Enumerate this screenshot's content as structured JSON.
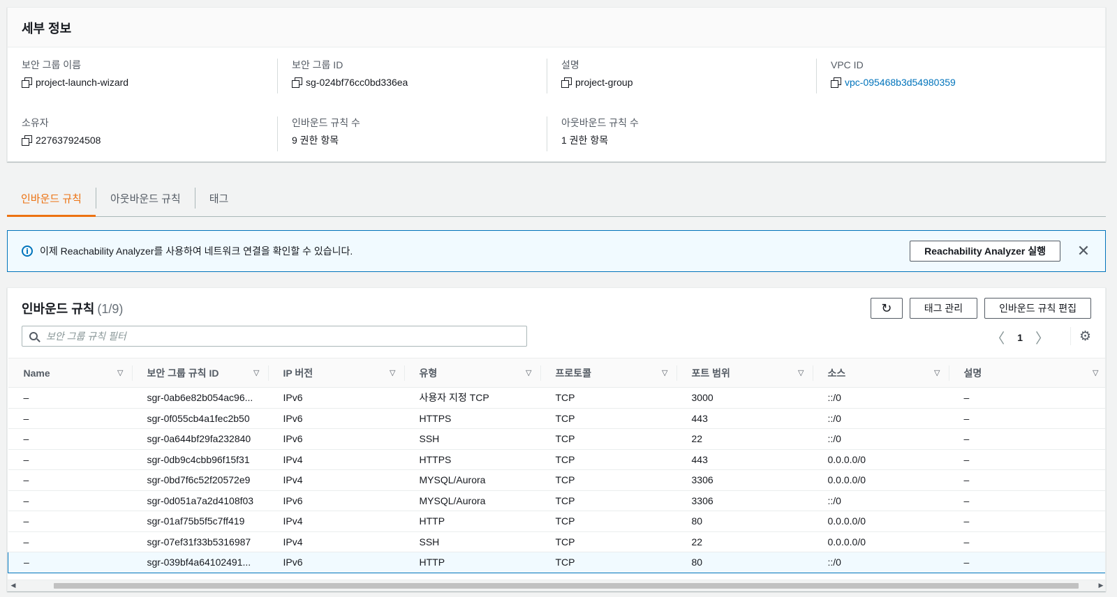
{
  "details": {
    "title": "세부 정보",
    "fields": [
      {
        "label": "보안 그룹 이름",
        "value": "project-launch-wizard"
      },
      {
        "label": "보안 그룹 ID",
        "value": "sg-024bf76cc0bd336ea"
      },
      {
        "label": "설명",
        "value": "project-group"
      },
      {
        "label": "VPC ID",
        "value": "vpc-095468b3d54980359"
      },
      {
        "label": "소유자",
        "value": "227637924508"
      },
      {
        "label": "인바운드 규칙 수",
        "value": "9 권한 항목"
      },
      {
        "label": "아웃바운드 규칙 수",
        "value": "1 권한 항목"
      }
    ]
  },
  "tabs": [
    {
      "label": "인바운드 규칙",
      "active": true
    },
    {
      "label": "아웃바운드 규칙",
      "active": false
    },
    {
      "label": "태그",
      "active": false
    }
  ],
  "flash": {
    "info_icon": "info-icon",
    "message": "이제 Reachability Analyzer를 사용하여 네트워크 연결을 확인할 수 있습니다.",
    "button": "Reachability Analyzer 실행",
    "close": "✕"
  },
  "rules_panel": {
    "title": "인바운드 규칙",
    "count": "(1/9)",
    "refresh_icon": "↻",
    "manage_tags": "태그 관리",
    "edit_rules": "인바운드 규칙 편집",
    "search_placeholder": "보안 그룹 규칙 필터",
    "page": "1",
    "prev": "〈",
    "next": "〉",
    "settings_icon": "⚙",
    "columns": [
      "Name",
      "보안 그룹 규칙 ID",
      "IP 버전",
      "유형",
      "프로토콜",
      "포트 범위",
      "소스",
      "설명"
    ],
    "sort_icon": "▽",
    "rows": [
      [
        "–",
        "sgr-0ab6e82b054ac96...",
        "IPv6",
        "사용자 지정 TCP",
        "TCP",
        "3000",
        "::/0",
        "–"
      ],
      [
        "–",
        "sgr-0f055cb4a1fec2b50",
        "IPv6",
        "HTTPS",
        "TCP",
        "443",
        "::/0",
        "–"
      ],
      [
        "–",
        "sgr-0a644bf29fa232840",
        "IPv6",
        "SSH",
        "TCP",
        "22",
        "::/0",
        "–"
      ],
      [
        "–",
        "sgr-0db9c4cbb96f15f31",
        "IPv4",
        "HTTPS",
        "TCP",
        "443",
        "0.0.0.0/0",
        "–"
      ],
      [
        "–",
        "sgr-0bd7f6c52f20572e9",
        "IPv4",
        "MYSQL/Aurora",
        "TCP",
        "3306",
        "0.0.0.0/0",
        "–"
      ],
      [
        "–",
        "sgr-0d051a7a2d4108f03",
        "IPv6",
        "MYSQL/Aurora",
        "TCP",
        "3306",
        "::/0",
        "–"
      ],
      [
        "–",
        "sgr-01af75b5f5c7ff419",
        "IPv4",
        "HTTP",
        "TCP",
        "80",
        "0.0.0.0/0",
        "–"
      ],
      [
        "–",
        "sgr-07ef31f33b5316987",
        "IPv4",
        "SSH",
        "TCP",
        "22",
        "0.0.0.0/0",
        "–"
      ],
      [
        "–",
        "sgr-039bf4a64102491...",
        "IPv6",
        "HTTP",
        "TCP",
        "80",
        "::/0",
        "–"
      ]
    ],
    "selected_row": 8
  },
  "colors": {
    "accent": "#ec7211",
    "link": "#0073bb",
    "info_bg": "#f1faff"
  }
}
